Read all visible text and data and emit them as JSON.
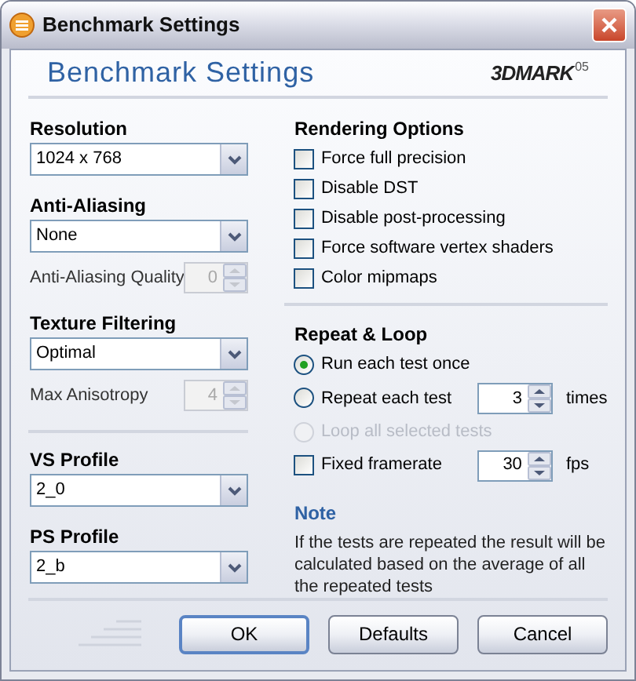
{
  "window": {
    "title": "Benchmark Settings"
  },
  "header": {
    "title": "Benchmark Settings",
    "logo": "3DMARK",
    "logo_edition": "05"
  },
  "left": {
    "groups": [
      [
        {
          "label": "Resolution",
          "dropdown": "1024 x 768"
        },
        {
          "label": "Anti-Aliasing",
          "dropdown": "None",
          "sub": {
            "label": "Anti-Aliasing Quality",
            "value": "0",
            "disabled": true
          }
        },
        {
          "label": "Texture Filtering",
          "dropdown": "Optimal",
          "sub": {
            "label": "Max Anisotropy",
            "value": "4",
            "disabled": true
          }
        }
      ],
      [
        {
          "label": "VS Profile",
          "dropdown": "2_0"
        },
        {
          "label": "PS Profile",
          "dropdown": "2_b"
        }
      ]
    ]
  },
  "rendering": {
    "title": "Rendering Options",
    "options": [
      {
        "label": "Force full precision",
        "checked": false
      },
      {
        "label": "Disable DST",
        "checked": false
      },
      {
        "label": "Disable post-processing",
        "checked": false
      },
      {
        "label": "Force software vertex shaders",
        "checked": false
      },
      {
        "label": "Color mipmaps",
        "checked": false
      }
    ]
  },
  "repeat": {
    "title": "Repeat & Loop",
    "options": [
      {
        "kind": "radio",
        "label": "Run each test once",
        "selected": true,
        "disabled": false
      },
      {
        "kind": "radio",
        "label": "Repeat each test",
        "selected": false,
        "disabled": false,
        "spin": {
          "value": "3",
          "disabled": false
        },
        "unit": "times"
      },
      {
        "kind": "radio",
        "label": "Loop all selected tests",
        "selected": false,
        "disabled": true
      },
      {
        "kind": "checkbox",
        "label": "Fixed framerate",
        "checked": false,
        "spin": {
          "value": "30",
          "disabled": false
        },
        "unit": "fps"
      }
    ]
  },
  "note": {
    "title": "Note",
    "text": "If the tests are repeated the result will be calculated based on the average of all the repeated tests"
  },
  "buttons": [
    {
      "label": "OK",
      "default": true
    },
    {
      "label": "Defaults",
      "default": false
    },
    {
      "label": "Cancel",
      "default": false
    }
  ]
}
